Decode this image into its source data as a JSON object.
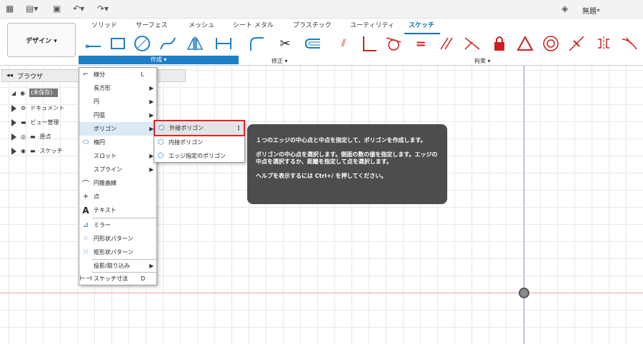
{
  "app": {
    "doc_title": "無題*"
  },
  "tabs": [
    {
      "label": "ソリッド"
    },
    {
      "label": "サーフェス"
    },
    {
      "label": "メッシュ"
    },
    {
      "label": "シート メタル"
    },
    {
      "label": "プラスチック"
    },
    {
      "label": "ユーティリティ"
    },
    {
      "label": "スケッチ"
    }
  ],
  "design_button": {
    "label": "デザイン ▾"
  },
  "groups": {
    "create": "作成 ▾",
    "modify": "修正 ▾",
    "constraints": "拘束 ▾"
  },
  "browser": {
    "title": "ブラウザ",
    "rows": [
      "(未保存)",
      "ドキュメント",
      "ビュー管理",
      "原点",
      "スケッチ"
    ]
  },
  "create_menu": {
    "items": [
      {
        "label": "線分",
        "shortcut": "L",
        "icon": "line-icon"
      },
      {
        "label": "長方形",
        "submenu": true
      },
      {
        "label": "円",
        "submenu": true
      },
      {
        "label": "円弧",
        "submenu": true
      },
      {
        "label": "ポリゴン",
        "submenu": true
      },
      {
        "label": "楕円",
        "icon": "ellipse-icon"
      },
      {
        "label": "スロット",
        "submenu": true
      },
      {
        "label": "スプライン",
        "submenu": true
      },
      {
        "label": "円錐曲線",
        "icon": "conic-curve-icon"
      },
      {
        "label": "点",
        "icon": "point-icon"
      },
      {
        "label": "テキスト",
        "icon": "text-icon"
      },
      {
        "label": "ミラー",
        "icon": "mirror-icon"
      },
      {
        "label": "円形状パターン",
        "icon": "circular-pattern-icon"
      },
      {
        "label": "矩形状パターン",
        "icon": "rectangular-pattern-icon"
      },
      {
        "label": "投影/取り込み",
        "submenu": true
      },
      {
        "label": "スケッチ寸法",
        "shortcut": "D",
        "icon": "sketch-dimension-icon"
      }
    ]
  },
  "polygon_submenu": {
    "items": [
      "外接ポリゴン",
      "内接ポリゴン",
      "エッジ指定のポリゴン"
    ]
  },
  "tooltip": {
    "line1": "１つのエッジの中心点と中点を指定して、ポリゴンを作成します。",
    "line2": "ポリゴンの中心点を選択します。側面の数の値を指定します。エッジの中点を選択するか、距離を指定して点を選択します。",
    "line3": "ヘルプを表示するには Ctrl+/ を押してください。"
  },
  "colors": {
    "accent": "#1f7ec5",
    "selection": "#e0232a",
    "tooltip_bg": "#4d4d4d"
  }
}
